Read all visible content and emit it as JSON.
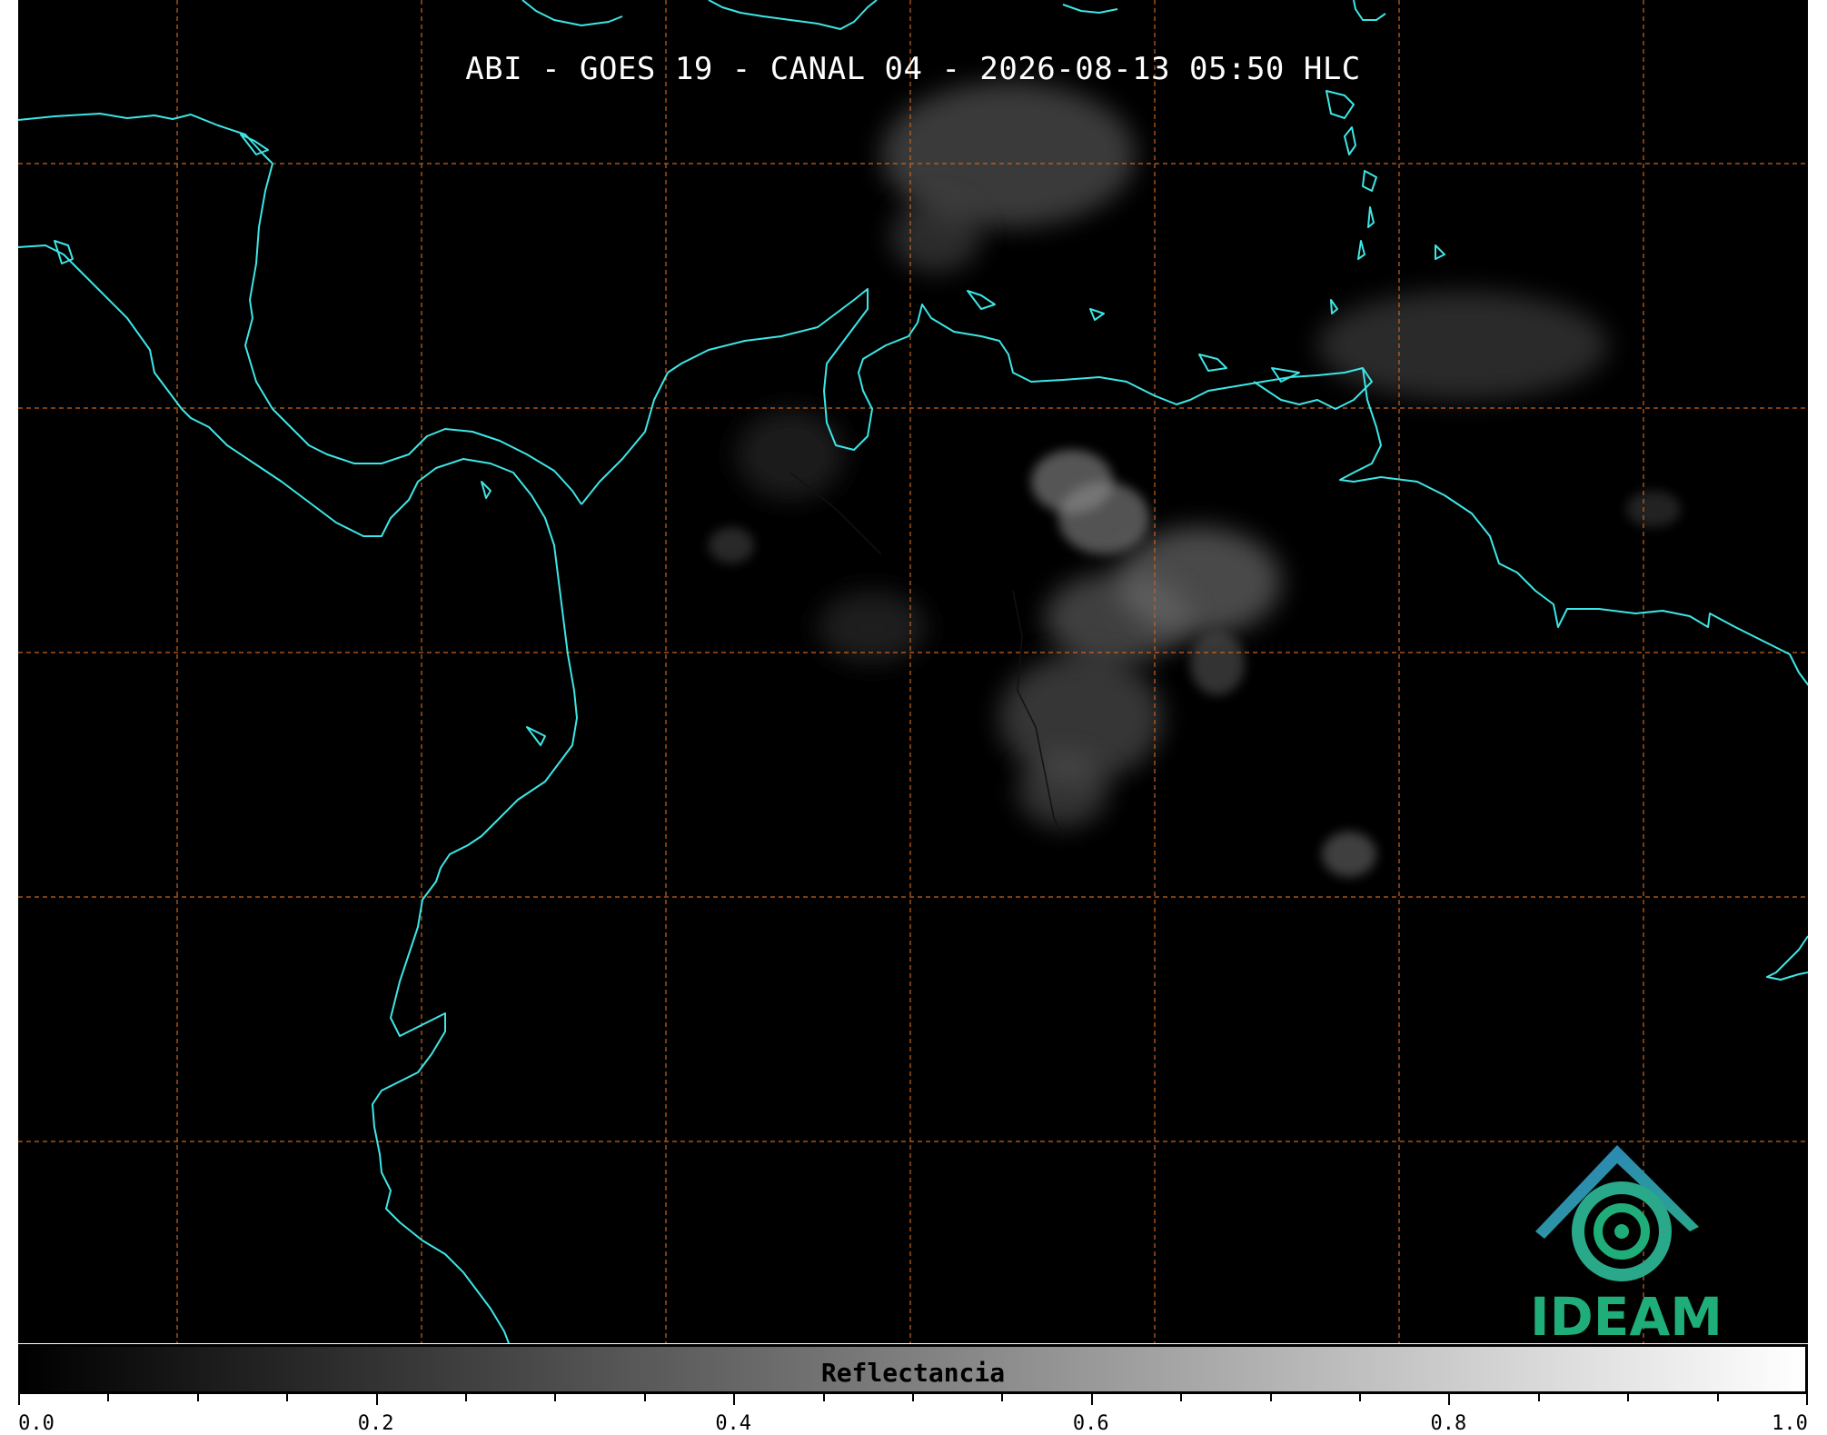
{
  "title": "ABI - GOES 19 - CANAL 04 - 2026-08-13 05:50 HLC",
  "colorbar": {
    "label": "Reflectancia",
    "min": 0.0,
    "max": 1.0,
    "gradient": "grayscale black-to-white",
    "tick_labels": [
      "0.0",
      "0.2",
      "0.4",
      "0.6",
      "0.8",
      "1.0"
    ],
    "minor_ticks_between_labels": 3
  },
  "logo": {
    "text": "IDEAM",
    "colors": {
      "text": "#1fae7a",
      "roof": "#2d7fc1",
      "swirl": "#2aa88a"
    }
  },
  "colors": {
    "coastline": "#3ee6e6",
    "gridlines": "#c8641e",
    "background": "#000000",
    "title_text": "#ffffff"
  },
  "map_features": {
    "coastline": "cyan",
    "gridlines": "dashed orange",
    "clouds": "faint gray convective cells"
  }
}
